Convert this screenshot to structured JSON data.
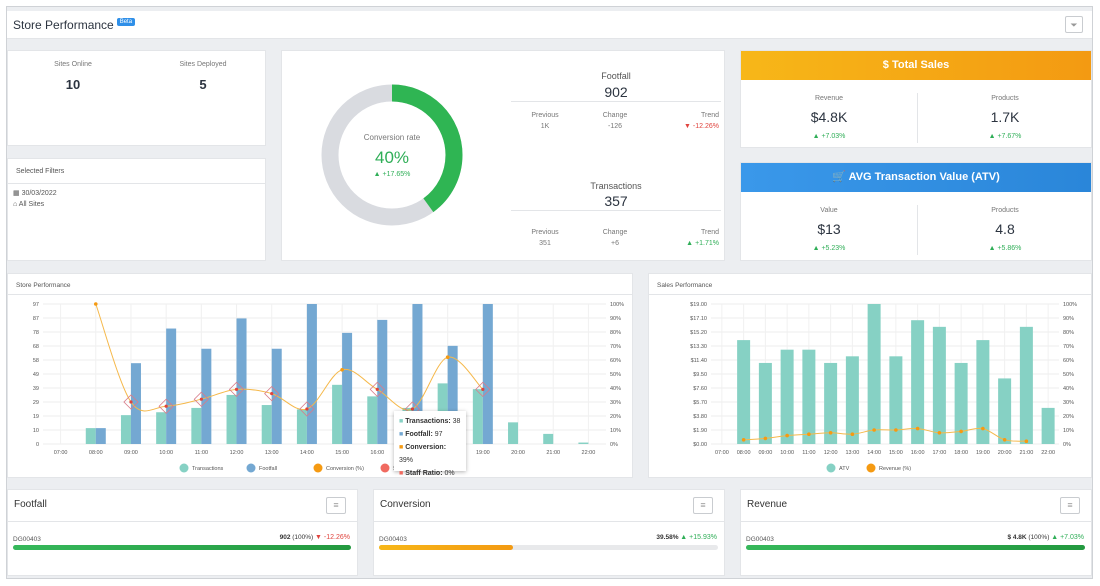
{
  "header": {
    "title": "Store Performance",
    "badge": "Beta",
    "filter_icon": "filter-icon"
  },
  "sites": {
    "online_label": "Sites Online",
    "online": "10",
    "deployed_label": "Sites Deployed",
    "deployed": "5"
  },
  "filters": {
    "title": "Selected Filters",
    "date": "30/03/2022",
    "site": "All Sites"
  },
  "conversion": {
    "label": "Conversion rate",
    "value": "40%",
    "value_fraction": 0.4,
    "trend": "+17.65%"
  },
  "footfall": {
    "title": "Footfall",
    "value": "902",
    "prev_label": "Previous",
    "prev": "1K",
    "change_label": "Change",
    "change": "-126",
    "trend_label": "Trend",
    "trend": "-12.26%"
  },
  "transactions": {
    "title": "Transactions",
    "value": "357",
    "prev_label": "Previous",
    "prev": "351",
    "change_label": "Change",
    "change": "+6",
    "trend_label": "Trend",
    "trend": "+1.71%"
  },
  "total_sales": {
    "title": "Total Sales",
    "revenue_label": "Revenue",
    "revenue": "$4.8K",
    "revenue_trend": "+7.03%",
    "products_label": "Products",
    "products": "1.7K",
    "products_trend": "+7.67%"
  },
  "atv": {
    "title": "AVG Transaction Value (ATV)",
    "value_label": "Value",
    "value": "$13",
    "value_trend": "+5.23%",
    "products_label": "Products",
    "products": "4.8",
    "products_trend": "+5.86%"
  },
  "colors": {
    "teal": "#86d1c4",
    "blue": "#74a8d2",
    "orange": "#f59a12",
    "green": "#2fae57",
    "red": "#e0443e",
    "accent_blue": "#2f8fe8"
  },
  "chart_data": [
    {
      "type": "bar",
      "title": "Store Performance",
      "categories": [
        "07:00",
        "08:00",
        "09:00",
        "10:00",
        "11:00",
        "12:00",
        "13:00",
        "14:00",
        "15:00",
        "16:00",
        "17:00",
        "18:00",
        "19:00",
        "20:00",
        "21:00",
        "22:00"
      ],
      "yticks": [
        "0",
        "10",
        "19",
        "29",
        "39",
        "49",
        "58",
        "68",
        "78",
        "87",
        "97"
      ],
      "ylim": [
        0,
        97
      ],
      "y2ticks": [
        "0%",
        "10%",
        "20%",
        "30%",
        "40%",
        "50%",
        "60%",
        "70%",
        "80%",
        "90%",
        "100%"
      ],
      "series": [
        {
          "name": "Transactions",
          "values": [
            null,
            11,
            20,
            22,
            25,
            34,
            27,
            24,
            41,
            33,
            25,
            42,
            38,
            15,
            7,
            1
          ]
        },
        {
          "name": "Footfall",
          "values": [
            null,
            11,
            56,
            80,
            66,
            87,
            66,
            97,
            77,
            86,
            97,
            68,
            97,
            0,
            0,
            0
          ]
        },
        {
          "name": "Conversion (%)",
          "values": [
            null,
            100,
            30,
            27,
            32,
            39,
            36,
            25,
            53,
            39,
            25,
            62,
            39,
            null,
            null,
            null
          ]
        },
        {
          "name": "Staff Ratio",
          "values": []
        }
      ],
      "tooltip": {
        "t_label": "Transactions:",
        "t": "38",
        "f_label": "Footfall:",
        "f": "97",
        "c_label": "Conversion:",
        "c": "39%",
        "s_label": "Staff Ratio:",
        "s": "0%"
      }
    },
    {
      "type": "bar",
      "title": "Sales Performance",
      "categories": [
        "07:00",
        "08:00",
        "09:00",
        "10:00",
        "11:00",
        "12:00",
        "13:00",
        "14:00",
        "15:00",
        "16:00",
        "17:00",
        "18:00",
        "19:00",
        "20:00",
        "21:00",
        "22:00"
      ],
      "yticks": [
        "$0.00",
        "$1.90",
        "$3.80",
        "$5.70",
        "$7.60",
        "$9.50",
        "$11.40",
        "$13.30",
        "$15.20",
        "$17.10",
        "$19.00"
      ],
      "ylim": [
        0,
        19
      ],
      "y2ticks": [
        "0%",
        "10%",
        "20%",
        "30%",
        "40%",
        "50%",
        "60%",
        "70%",
        "80%",
        "90%",
        "100%"
      ],
      "series": [
        {
          "name": "ATV",
          "values": [
            null,
            14.1,
            11.0,
            12.8,
            12.8,
            11.0,
            11.9,
            19.0,
            11.9,
            16.8,
            15.9,
            11.0,
            14.1,
            8.9,
            15.9,
            4.9
          ]
        },
        {
          "name": "Revenue (%)",
          "values": [
            null,
            3,
            4,
            6,
            7,
            8,
            7,
            10,
            10,
            11,
            8,
            9,
            11,
            3,
            2,
            null
          ]
        }
      ]
    }
  ],
  "bottom": [
    {
      "title": "Footfall",
      "site": "DG00403",
      "value": "902",
      "pct": "(100%)",
      "trend": "-12.26%",
      "dir": "down",
      "fill": 1.0
    },
    {
      "title": "Conversion",
      "site": "DG00403",
      "value": "39.58%",
      "pct": "",
      "trend": "+15.93%",
      "dir": "up",
      "fill": 0.3958
    },
    {
      "title": "Revenue",
      "site": "DG00403",
      "value": "$ 4.8K",
      "pct": "(100%)",
      "trend": "+7.03%",
      "dir": "up",
      "fill": 1.0
    }
  ]
}
